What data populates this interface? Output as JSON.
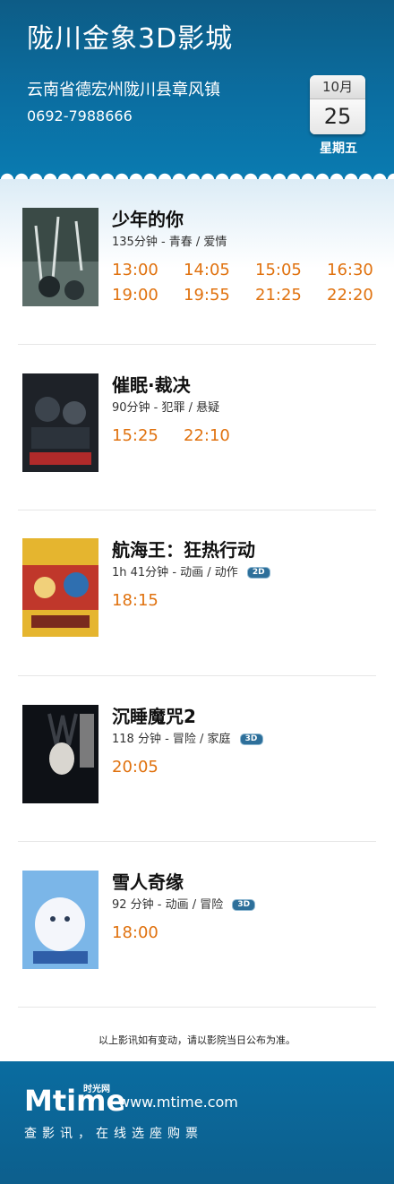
{
  "header": {
    "cinema_name": "陇川金象3D影城",
    "address": "云南省德宏州陇川县章风镇",
    "phone": "0692-7988666",
    "calendar": {
      "month": "10月",
      "day": "25",
      "weekday": "星期五"
    }
  },
  "movies": [
    {
      "title": "少年的你",
      "meta": "135分钟 - 青春 / 爱情",
      "format_badge": "",
      "poster_colors": [
        "#2a3a36",
        "#6e7f7a"
      ],
      "showtimes": [
        "13:00",
        "14:05",
        "15:05",
        "16:30",
        "19:00",
        "19:55",
        "21:25",
        "22:20"
      ]
    },
    {
      "title": "催眠·裁决",
      "meta": "90分钟 - 犯罪 / 悬疑",
      "format_badge": "",
      "poster_colors": [
        "#1e2228",
        "#b02a2a"
      ],
      "showtimes": [
        "15:25",
        "22:10"
      ]
    },
    {
      "title": "航海王：狂热行动",
      "meta": "1h 41分钟 - 动画 / 动作",
      "format_badge": "2D",
      "poster_colors": [
        "#d8a52a",
        "#c0372b"
      ],
      "showtimes": [
        "18:15"
      ]
    },
    {
      "title": "沉睡魔咒2",
      "meta": "118 分钟 - 冒险 / 家庭",
      "format_badge": "3D",
      "poster_colors": [
        "#0e1116",
        "#e8e6e2"
      ],
      "showtimes": [
        "20:05"
      ]
    },
    {
      "title": "雪人奇缘",
      "meta": "92 分钟 - 动画 / 冒险",
      "format_badge": "3D",
      "poster_colors": [
        "#7bb6e8",
        "#f4f6fb"
      ],
      "showtimes": [
        "18:00"
      ]
    }
  ],
  "notice": "以上影讯如有变动，请以影院当日公布为准。",
  "footer": {
    "logo_text": "Mtime",
    "logo_cn": "时光网",
    "website": "www.mtime.com",
    "slogan": "查影讯，在线选座购票"
  },
  "colors": {
    "header_blue": "#0b6ea1",
    "showtime_orange": "#e0720f",
    "badge_blue": "#2d6f9a"
  }
}
